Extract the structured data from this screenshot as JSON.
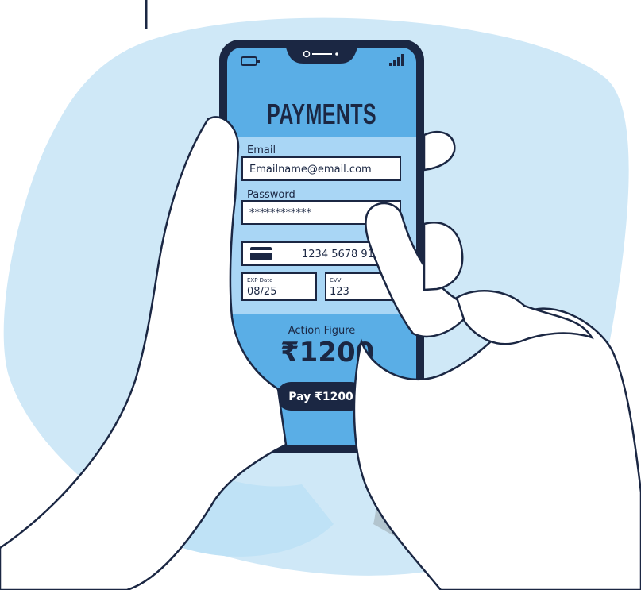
{
  "screen": {
    "title": "PAYMENTS",
    "email_label": "Email",
    "email_value": "Emailname@email.com",
    "password_label": "Password",
    "password_value": "************",
    "card_number": "1234 5678 910",
    "exp_label": "EXP Date",
    "exp_value": "08/25",
    "cvv_label": "CVV",
    "cvv_value": "123",
    "product_name": "Action Figure",
    "amount": "₹1200",
    "pay_button_label": "Pay ₹1200"
  },
  "colors": {
    "blob_background": "#cfe8f7",
    "phone_frame": "#1b2743",
    "screen_header": "#5aaee6",
    "screen_form": "#a9d6f5",
    "screen_footer": "#5aaee6",
    "hand_shadow": "#bfe2f6",
    "pay_button": "#1b2743"
  },
  "icons": [
    "battery-icon",
    "camera-notch-icon",
    "signal-icon",
    "credit-card-icon"
  ]
}
